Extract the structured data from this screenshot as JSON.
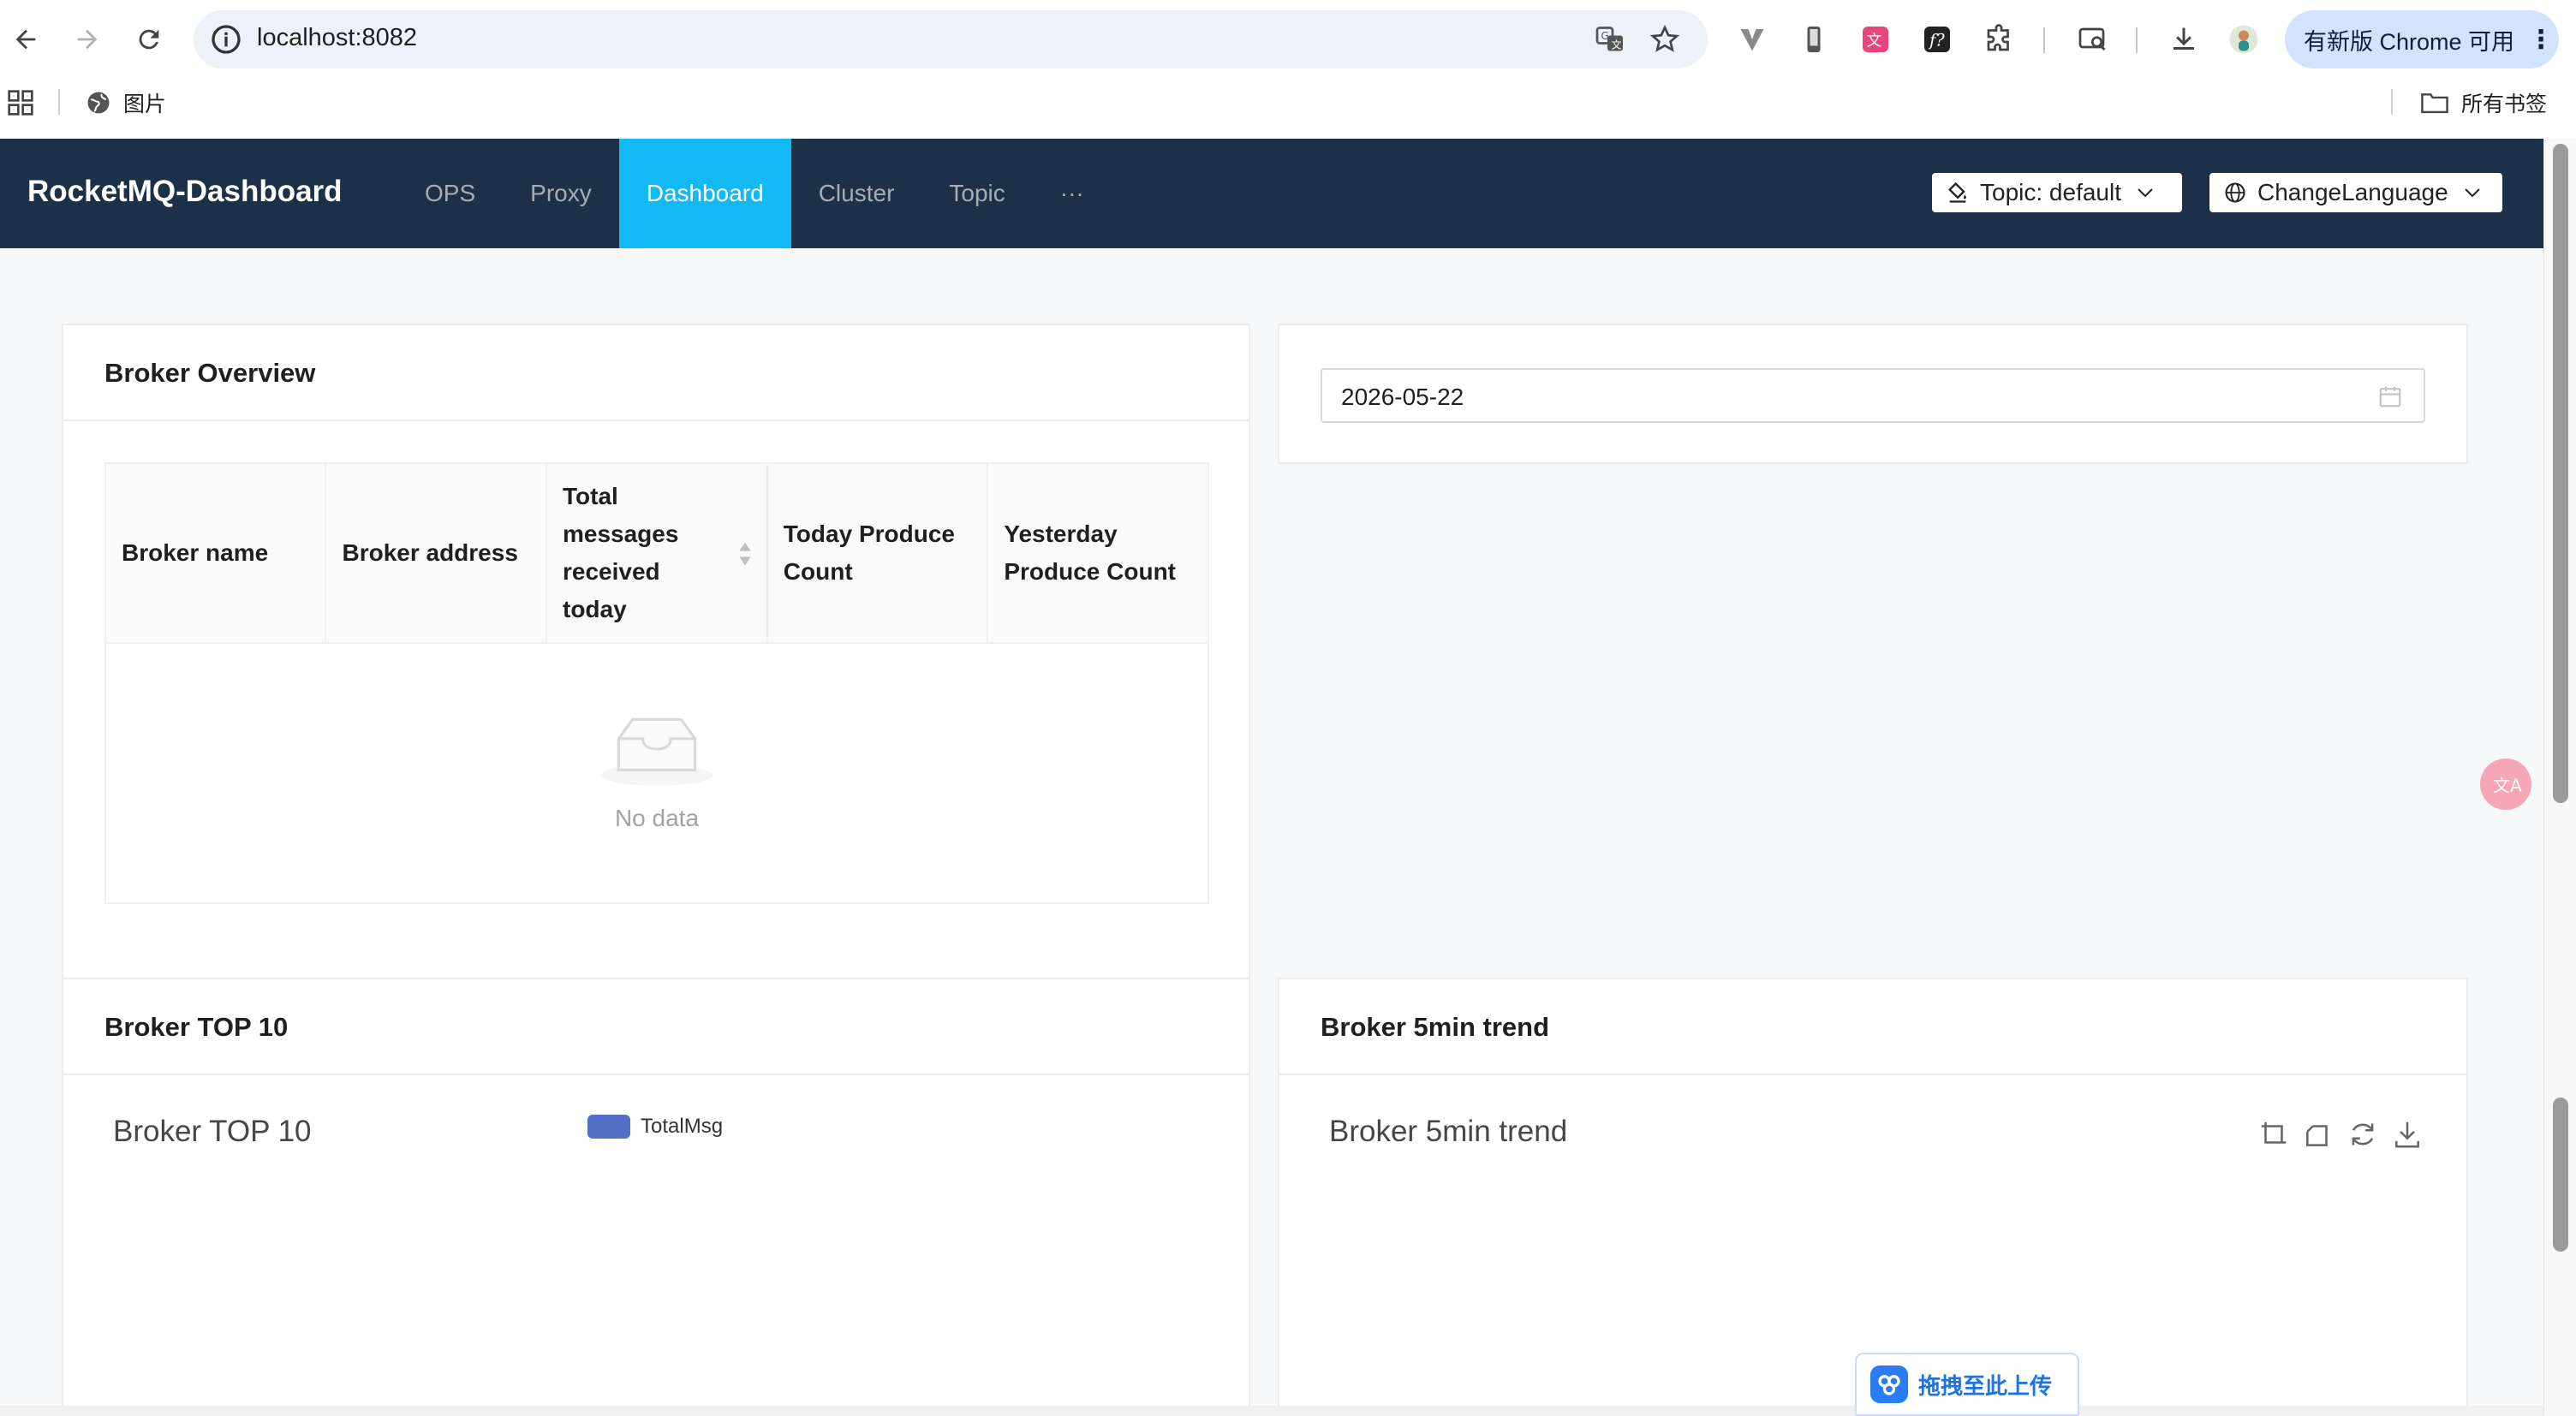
{
  "browser": {
    "url": "localhost:8082",
    "update_label": "有新版 Chrome 可用",
    "update_dots": "⋮",
    "bookmark_item": "图片",
    "all_bookmarks": "所有书签"
  },
  "app": {
    "logo": "RocketMQ-Dashboard",
    "menu": [
      {
        "label": "OPS"
      },
      {
        "label": "Proxy"
      },
      {
        "label": "Dashboard",
        "active": true
      },
      {
        "label": "Cluster"
      },
      {
        "label": "Topic"
      },
      {
        "label": "···"
      }
    ],
    "topic_select": "Topic: default",
    "language_select": "ChangeLanguage",
    "accent_color": "#13b9f2",
    "header_color": "#1c3147"
  },
  "broker_overview": {
    "title": "Broker Overview",
    "columns": [
      "Broker name",
      "Broker address",
      "Total messages received today",
      "Today Produce Count",
      "Yesterday Produce Count"
    ],
    "rows": [],
    "empty_text": "No data"
  },
  "date_picker": {
    "value": "2026-05-22"
  },
  "broker_top10": {
    "card_title": "Broker TOP 10",
    "chart_title": "Broker TOP 10",
    "legend": "TotalMsg",
    "legend_color": "#5470c6"
  },
  "broker_trend": {
    "card_title": "Broker 5min trend",
    "chart_title": "Broker 5min trend"
  },
  "chart_data": [
    {
      "type": "bar",
      "title": "Broker TOP 10",
      "series": [
        {
          "name": "TotalMsg",
          "values": []
        }
      ],
      "categories": []
    },
    {
      "type": "line",
      "title": "Broker 5min trend",
      "series": [],
      "x": []
    }
  ],
  "upload": {
    "label": "拖拽至此上传"
  }
}
